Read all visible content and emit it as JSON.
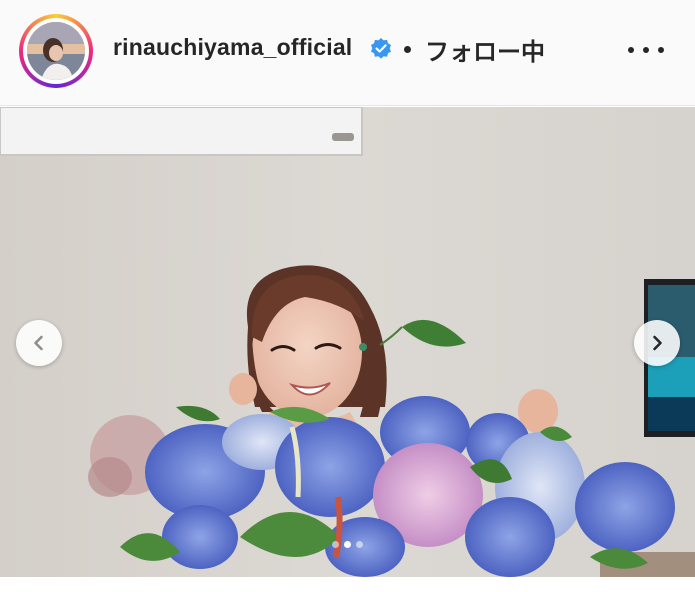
{
  "post_header": {
    "username": "rinauchiyama_official",
    "separator": "・",
    "follow_status": "フォロー中",
    "verified": true,
    "avatar_icon": "profile-photo",
    "more_icon": "ellipsis-icon",
    "story_ring_colors": [
      "#f9ce34",
      "#ee2a7b",
      "#6228d7"
    ]
  },
  "carousel": {
    "total_slides": 3,
    "current_slide": 2,
    "prev_icon": "chevron-left-icon",
    "next_icon": "chevron-right-icon"
  },
  "colors": {
    "text": "#262626",
    "verified_badge": "#3897f0",
    "header_bg": "#fafafa"
  }
}
